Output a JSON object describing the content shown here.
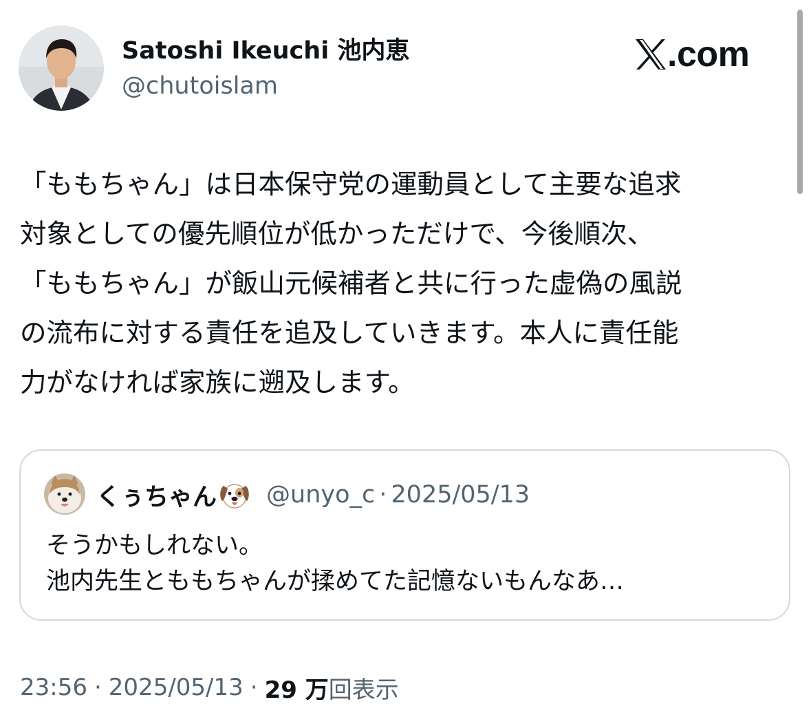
{
  "author": {
    "display_name": "Satoshi Ikeuchi 池内恵",
    "handle": "@chutoislam",
    "avatar": "profile-photo"
  },
  "site_badge": {
    "text": ".com",
    "icon": "x-logo-icon"
  },
  "tweet": {
    "lines": [
      "「ももちゃん」は日本保守党の運動員として主要な追求",
      "対象としての優先順位が低かっただけで、今後順次、",
      "「ももちゃん」が飯山元候補者と共に行った虚偽の風説",
      "の流布に対する責任を追及していきます。本人に責任能",
      "力がなければ家族に遡及します。"
    ]
  },
  "quoted_tweet": {
    "display_name": "くぅちゃん",
    "name_emoji": "dog-face-icon",
    "handle": "@unyo_c",
    "separator": "·",
    "date": "2025/05/13",
    "lines": [
      "そうかもしれない。",
      "池内先生とももちゃんが揉めてた記憶ないもんなあ…"
    ]
  },
  "meta": {
    "time": "23:56",
    "separator": "·",
    "date": "2025/05/13",
    "views_count": "29 万",
    "views_label": "回表示"
  },
  "colors": {
    "text_primary": "#0f1419",
    "text_secondary": "#536471",
    "border": "#cfd9de",
    "background": "#ffffff"
  }
}
